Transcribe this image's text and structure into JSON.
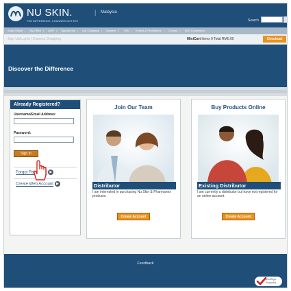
{
  "header": {
    "brand": "NU SKIN.",
    "tagline": "THE DIFFERENCE, CHANGED NOT EST",
    "separator": "|",
    "country": "Malaysia",
    "search_label": "Search"
  },
  "nav": {
    "items": [
      "Shop Online",
      "My Office",
      "ARO",
      "Opportunity",
      "Our Company",
      "Scanner",
      "TRA",
      "Events & Promotions",
      "Contact",
      "SEA Convention"
    ]
  },
  "subbar": {
    "signup": "Sign Up/Log In | Express Shopping",
    "minicart_label": "MiniCart",
    "minicart_text": "Items  0  Total  RM0.00",
    "checkout": "Checkout"
  },
  "banner": {
    "title": "Discover the Difference"
  },
  "login": {
    "title": "Already Registered?",
    "username_label": "Username/Email Address:",
    "username_value": "",
    "password_label": "Password:",
    "password_value": "",
    "signin_label": "Sign In",
    "forgot_link": "Forgot Password",
    "create_link": "Create Web Account"
  },
  "cards": {
    "join": {
      "title": "Join Our Team",
      "role": "Distributor",
      "desc": "I am interested in purchasing Nu Skin & Pharmanex products.",
      "button": "Create Account"
    },
    "buy": {
      "title": "Buy Products Online",
      "role": "Existing Distributor",
      "desc": "I am currently a distributor but have not registered for an online account.",
      "button": "Create Account"
    }
  },
  "footer": {
    "feedback": "Feedback",
    "seal_text": "VeriSign Secured"
  },
  "icons": {
    "logo": "nu-skin-logo-icon",
    "cursor": "hand-pointer-icon",
    "link_arrow": "arrow-right-circle-icon",
    "seal": "verisign-check-icon"
  },
  "colors": {
    "brand_blue": "#1f4e79",
    "accent_orange": "#e8921f"
  }
}
